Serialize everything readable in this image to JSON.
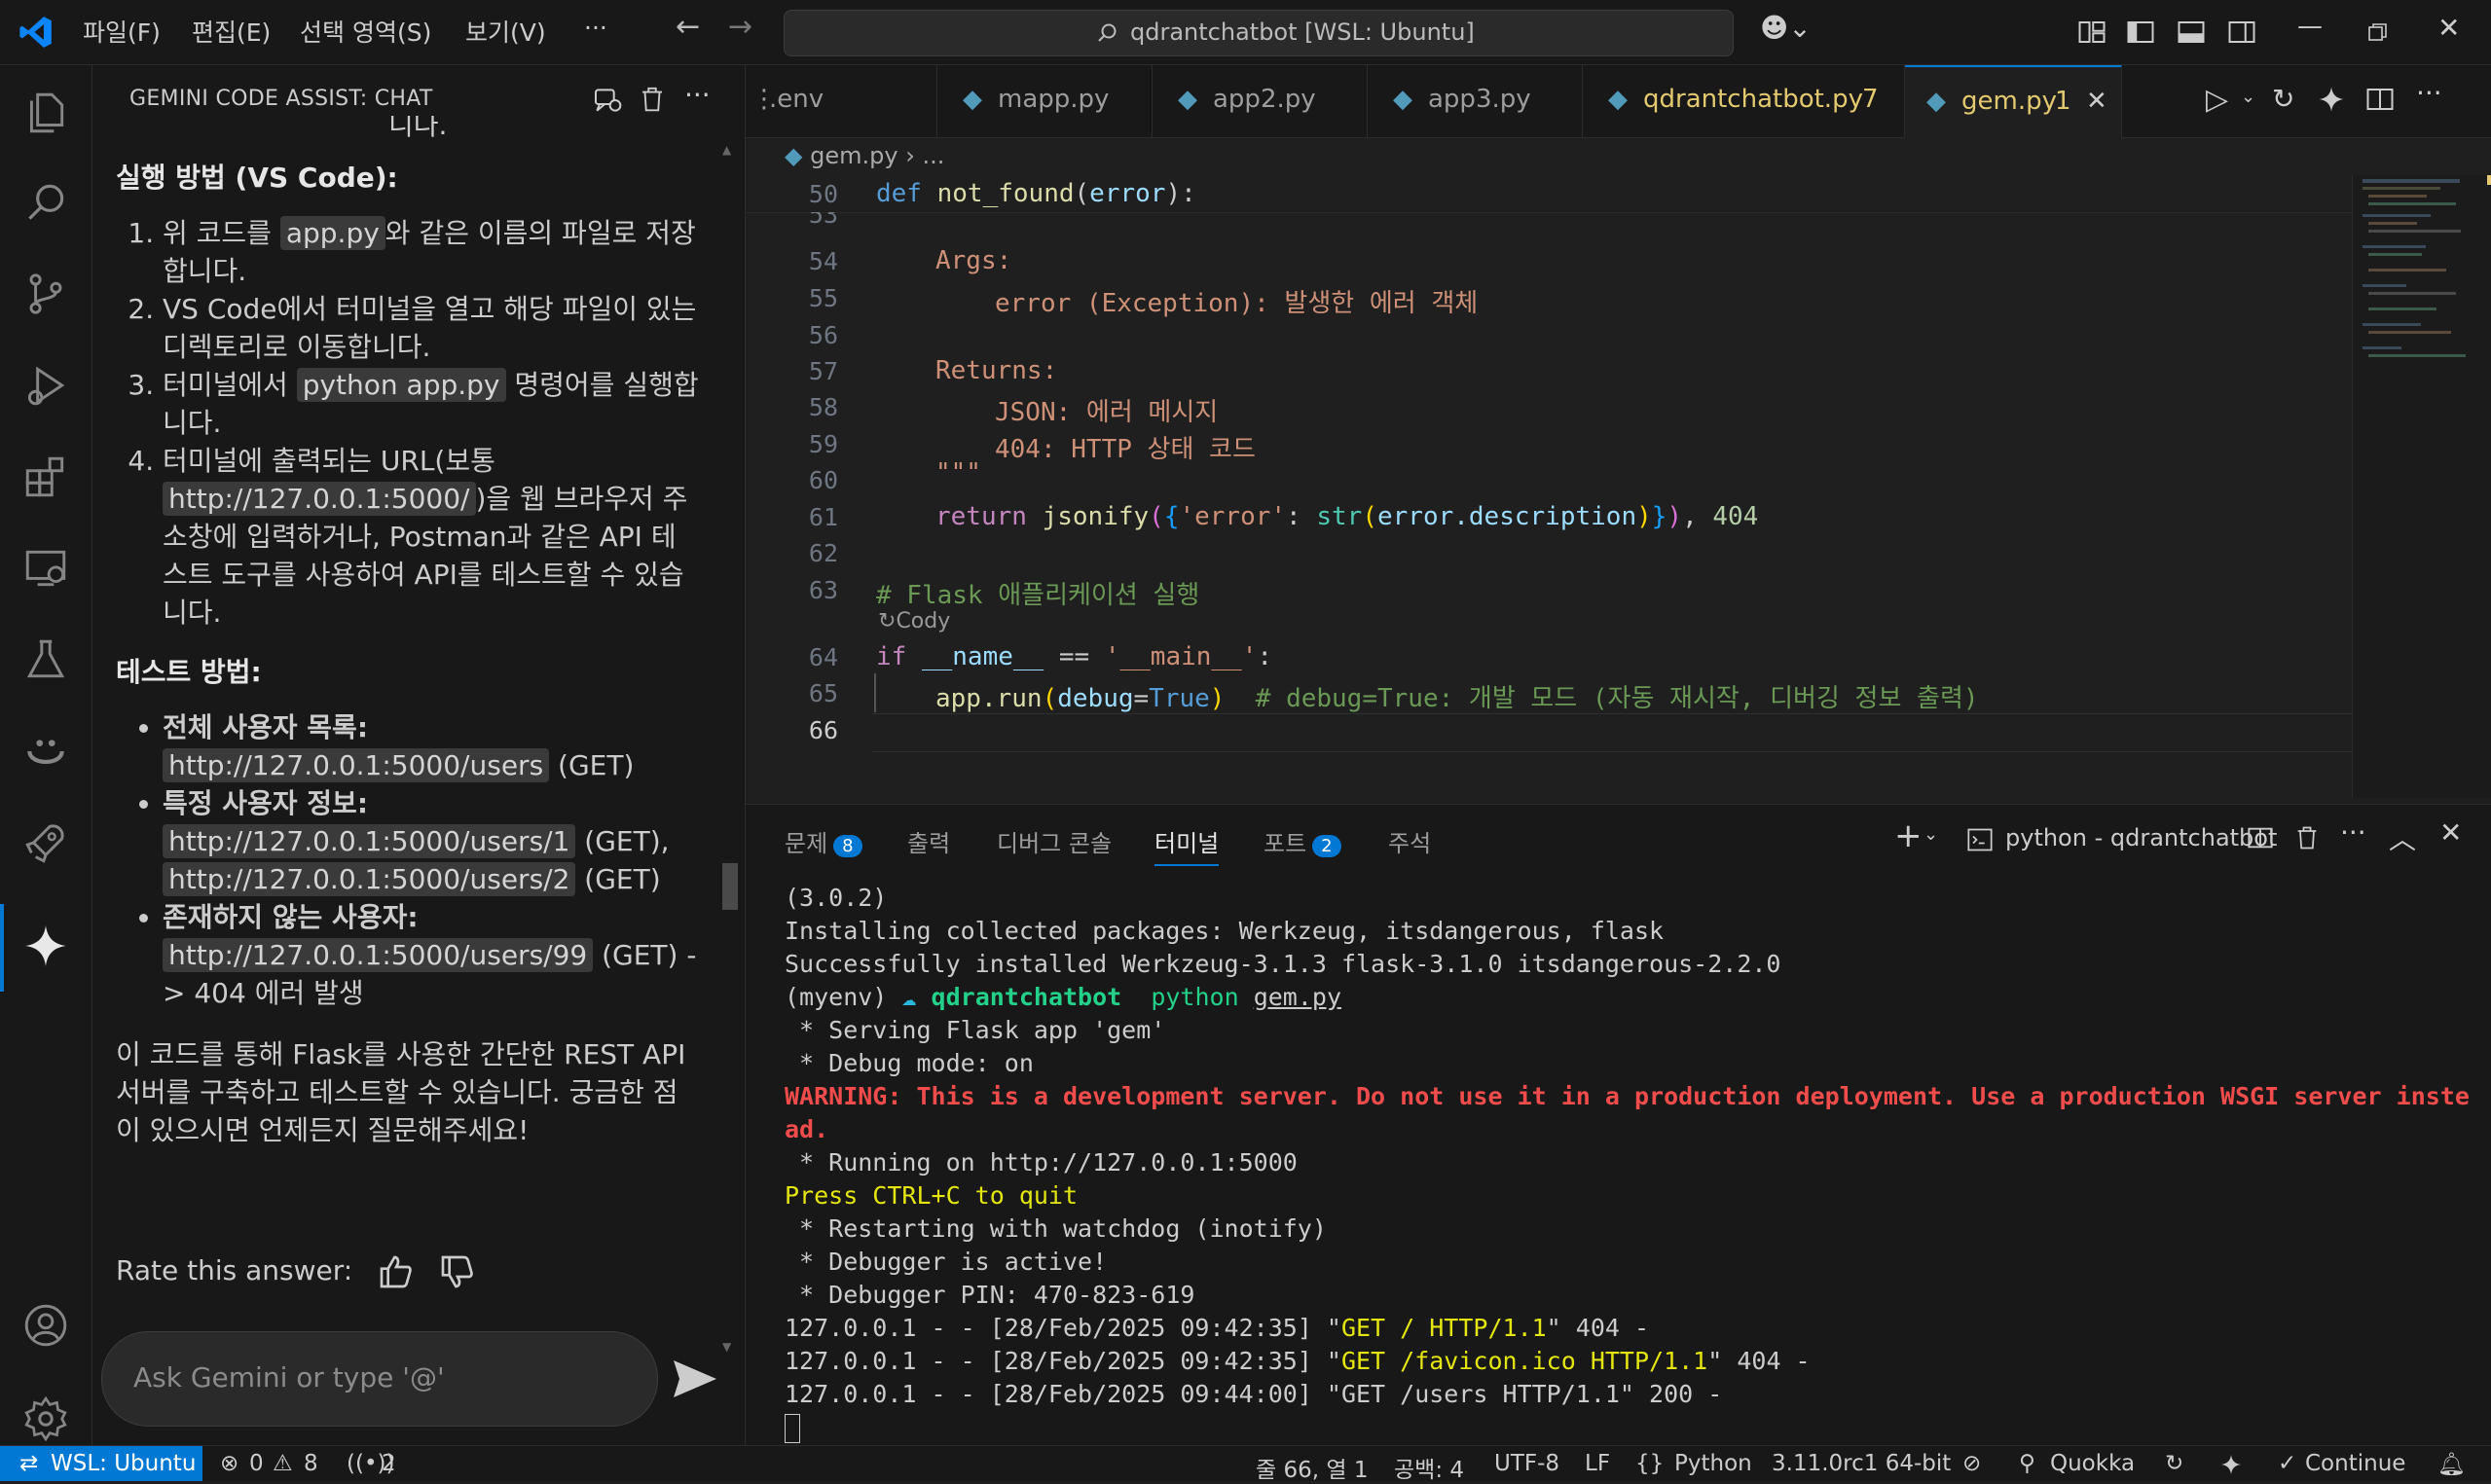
{
  "titlebar": {
    "menus": [
      "파일(F)",
      "편집(E)",
      "선택 영역(S)",
      "보기(V)",
      "···"
    ],
    "search": "qdrantchatbot [WSL: Ubuntu]"
  },
  "sidebar": {
    "title": "GEMINI CODE ASSIST: CHAT",
    "truncated_text": "니다.",
    "run_heading": "실행 방법 (VS Code):",
    "steps": {
      "s1a": "위 코드를 ",
      "s1code": "app.py",
      "s1b": "와 같은 이름의 파일로 저장합니다.",
      "s2": "VS Code에서 터미널을 열고 해당 파일이 있는 디렉토리로 이동합니다.",
      "s3a": "터미널에서 ",
      "s3code": "python app.py",
      "s3b": " 명령어를 실행합니다.",
      "s4a": "터미널에 출력되는 URL(보통 ",
      "s4code": "http://127.0.0.1:5000/",
      "s4b": ")을 웹 브라우저 주소창에 입력하거나, Postman과 같은 API 테스트 도구를 사용하여 API를 테스트할 수 있습니다."
    },
    "test_heading": "테스트 방법:",
    "tests": {
      "t1_label": "전체 사용자 목록:",
      "t1_url": "http://127.0.0.1:5000/users",
      "t1_method": " (GET)",
      "t2_label": "특정 사용자 정보:",
      "t2_url1": "http://127.0.0.1:5000/users/1",
      "t2_method1": " (GET),",
      "t2_url2": "http://127.0.0.1:5000/users/2",
      "t2_method2": " (GET)",
      "t3_label": "존재하지 않는 사용자:",
      "t3_url": "http://127.0.0.1:5000/users/99",
      "t3_rest": " (GET) -> 404 에러 발생"
    },
    "summary": "이 코드를 통해 Flask를 사용한 간단한 REST API 서버를 구축하고 테스트할 수 있습니다. 궁금한 점이 있으시면 언제든지 질문해주세요!",
    "rate_label": "Rate this answer:",
    "input_placeholder": "Ask Gemini or type '@'"
  },
  "tabs": [
    {
      "label": ".env"
    },
    {
      "label": "mapp.py"
    },
    {
      "label": "app2.py"
    },
    {
      "label": "app3.py"
    },
    {
      "label": "qdrantchatbot.py",
      "count": "7"
    },
    {
      "label": "gem.py",
      "count": "1"
    }
  ],
  "breadcrumb": {
    "file": "gem.py",
    "rest": "..."
  },
  "editor": {
    "line_numbers": {
      "l50": "50",
      "l53": "53",
      "l54": "54",
      "l55": "55",
      "l56": "56",
      "l57": "57",
      "l58": "58",
      "l59": "59",
      "l60": "60",
      "l61": "61",
      "l62": "62",
      "l63": "63",
      "l64": "64",
      "l65": "65",
      "l66": "66"
    },
    "codelens": "Cody",
    "lines": {
      "def_kw": "def",
      "def_fn": "not_found",
      "def_param": "error",
      "args": "Args:",
      "args_desc": "error (Exception): 발생한 에러 객체",
      "returns": "Returns:",
      "ret1": "JSON: 에러 메시지",
      "ret2": "404: HTTP 상태 코드",
      "docend": "\"\"\"",
      "return_kw": "return",
      "jsonify": "jsonify",
      "err_key": "'error'",
      "str_fn": "str",
      "err_desc": "error.description",
      "code404": "404",
      "comment63": "# Flask 애플리케이션 실행",
      "if_kw": "if",
      "name_var": "__name__",
      "main_str": "'__main__'",
      "app_run": "app.run",
      "debug_kw": "debug",
      "true_kw": "True",
      "comment65": "# debug=True: 개발 모드 (자동 재시작, 디버깅 정보 출력)"
    }
  },
  "panel": {
    "tabs": [
      {
        "label": "문제",
        "badge": "8"
      },
      {
        "label": "출력"
      },
      {
        "label": "디버그 콘솔"
      },
      {
        "label": "터미널"
      },
      {
        "label": "포트",
        "badge": "2"
      },
      {
        "label": "주석"
      }
    ],
    "terminal_name": "python - qdrantchatbot",
    "terminal": {
      "l1": "(3.0.2)",
      "l2": "Installing collected packages: Werkzeug, itsdangerous, flask",
      "l3": "Successfully installed Werkzeug-3.1.3 flask-3.1.0 itsdangerous-2.2.0",
      "l4_env": "(myenv) ",
      "l4_dir": "qdrantchatbot",
      "l4_cmd": "python",
      "l4_arg": "gem.py",
      "l5": " * Serving Flask app 'gem'",
      "l6": " * Debug mode: on",
      "l7": "WARNING: This is a development server. Do not use it in a production deployment. Use a production WSGI server inste",
      "l8": "ad.",
      "l9": " * Running on http://127.0.0.1:5000",
      "l10": "Press CTRL+C to quit",
      "l11": " * Restarting with watchdog (inotify)",
      "l12": " * Debugger is active!",
      "l13": " * Debugger PIN: 470-823-619",
      "l14a": "127.0.0.1 - - [28/Feb/2025 09:42:35] \"",
      "l14b": "GET / HTTP/1.1",
      "l14c": "\" 404 -",
      "l15a": "127.0.0.1 - - [28/Feb/2025 09:42:35] \"",
      "l15b": "GET /favicon.ico HTTP/1.1",
      "l15c": "\" 404 -",
      "l16": "127.0.0.1 - - [28/Feb/2025 09:44:00] \"GET /users HTTP/1.1\" 200 -"
    }
  },
  "statusbar": {
    "remote": "WSL: Ubuntu",
    "errors": "0",
    "warnings": "8",
    "ports": "2",
    "position": "줄 66, 열 1",
    "spaces": "공백: 4",
    "encoding": "UTF-8",
    "eol": "LF",
    "language": "Python",
    "interpreter": "3.11.0rc1 64-bit",
    "quokka": "Quokka",
    "continue": "Continue"
  },
  "colors": {
    "accent": "#0078d4",
    "warning_text": "#f14c4c",
    "modified_tab": "#e3c96f"
  }
}
